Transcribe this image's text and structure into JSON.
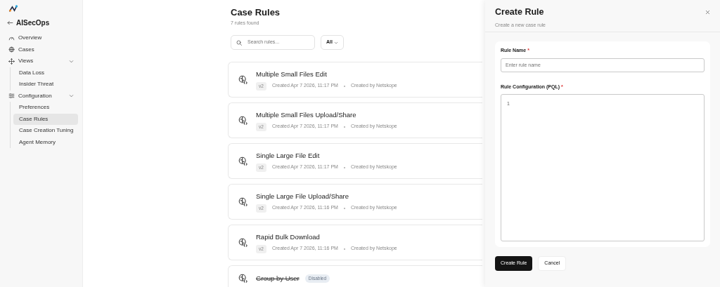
{
  "sidebar": {
    "back_label": "AISecOps",
    "items": [
      {
        "label": "Overview",
        "selected": false
      },
      {
        "label": "Cases",
        "selected": false
      },
      {
        "label": "Views",
        "expanded": true,
        "children": [
          {
            "label": "Data Loss",
            "selected": false
          },
          {
            "label": "Insider Threat",
            "selected": false
          }
        ]
      },
      {
        "label": "Configuration",
        "expanded": true,
        "children": [
          {
            "label": "Preferences",
            "selected": false
          },
          {
            "label": "Case Rules",
            "selected": true
          },
          {
            "label": "Case Creation Tuning",
            "selected": false
          },
          {
            "label": "Agent Memory",
            "selected": false
          }
        ]
      }
    ]
  },
  "page": {
    "title": "Case Rules",
    "subtitle": "7 rules found",
    "search": {
      "placeholder": "Search rules..."
    },
    "filter": {
      "value": "All"
    }
  },
  "rules": [
    {
      "title": "Multiple Small Files Edit",
      "disabled": false,
      "version": "v2",
      "created": "Created Apr 7 2026, 11:17 PM",
      "author": "Created by Netskope"
    },
    {
      "title": "Multiple Small Files Upload/Share",
      "disabled": false,
      "version": "v2",
      "created": "Created Apr 7 2026, 11:17 PM",
      "author": "Created by Netskope"
    },
    {
      "title": "Single Large File Edit",
      "disabled": false,
      "version": "v2",
      "created": "Created Apr 7 2026, 11:17 PM",
      "author": "Created by Netskope"
    },
    {
      "title": "Single Large File Upload/Share",
      "disabled": false,
      "version": "v2",
      "created": "Created Apr 7 2026, 11:16 PM",
      "author": "Created by Netskope"
    },
    {
      "title": "Rapid Bulk Download",
      "disabled": false,
      "version": "v2",
      "created": "Created Apr 7 2026, 11:16 PM",
      "author": "Created by Netskope"
    },
    {
      "title": "Group by User",
      "disabled": true,
      "badge": "Disabled"
    }
  ],
  "drawer": {
    "title": "Create Rule",
    "subtitle": "Create a new case rule",
    "fields": [
      {
        "kind": "input",
        "label": "Rule Name",
        "required_mark": "*",
        "placeholder": "Enter rule name"
      },
      {
        "kind": "code",
        "label": "Rule Configuration (PQL)",
        "required_mark": "*",
        "line_number": "1"
      }
    ],
    "buttons": [
      {
        "kind": "primary",
        "label": "Create Rule"
      },
      {
        "kind": "secondary",
        "label": "Cancel"
      }
    ]
  }
}
